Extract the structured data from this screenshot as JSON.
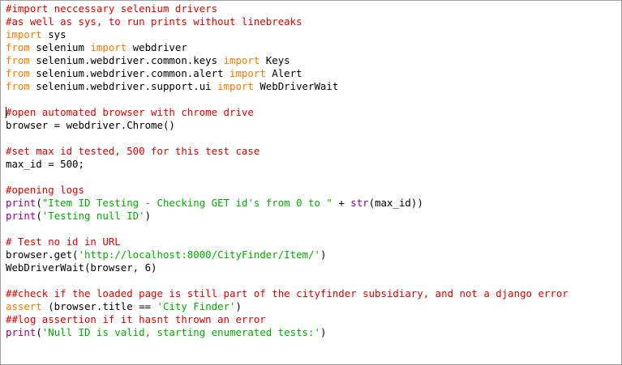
{
  "editor": {
    "colors": {
      "comment": "#dd0000",
      "keyword": "#ff7700",
      "builtin": "#900090",
      "string": "#00aa00",
      "text": "#000000",
      "background": "#ffffff"
    },
    "lines": [
      [
        {
          "t": "#import neccessary selenium drivers",
          "c": "c"
        }
      ],
      [
        {
          "t": "#as well as sys, to run prints without linebreaks",
          "c": "c"
        }
      ],
      [
        {
          "t": "import",
          "c": "k"
        },
        {
          "t": " sys",
          "c": "p"
        }
      ],
      [
        {
          "t": "from",
          "c": "k"
        },
        {
          "t": " selenium ",
          "c": "p"
        },
        {
          "t": "import",
          "c": "k"
        },
        {
          "t": " webdriver",
          "c": "p"
        }
      ],
      [
        {
          "t": "from",
          "c": "k"
        },
        {
          "t": " selenium.webdriver.common.keys ",
          "c": "p"
        },
        {
          "t": "import",
          "c": "k"
        },
        {
          "t": " Keys",
          "c": "p"
        }
      ],
      [
        {
          "t": "from",
          "c": "k"
        },
        {
          "t": " selenium.webdriver.common.alert ",
          "c": "p"
        },
        {
          "t": "import",
          "c": "k"
        },
        {
          "t": " Alert",
          "c": "p"
        }
      ],
      [
        {
          "t": "from",
          "c": "k"
        },
        {
          "t": " selenium.webdriver.support.ui ",
          "c": "p"
        },
        {
          "t": "import",
          "c": "k"
        },
        {
          "t": " WebDriverWait",
          "c": "p"
        }
      ],
      [],
      [
        {
          "t": "#open automated browser with chrome drive",
          "c": "c",
          "caret": true
        }
      ],
      [
        {
          "t": "browser = webdriver.Chrome()",
          "c": "p"
        }
      ],
      [],
      [
        {
          "t": "#set max id tested, 500 for this test case",
          "c": "c"
        }
      ],
      [
        {
          "t": "max_id = 500;",
          "c": "p"
        }
      ],
      [],
      [
        {
          "t": "#opening logs",
          "c": "c"
        }
      ],
      [
        {
          "t": "print",
          "c": "b"
        },
        {
          "t": "(",
          "c": "p"
        },
        {
          "t": "\"Item ID Testing - Checking GET id's from 0 to \"",
          "c": "s"
        },
        {
          "t": " + ",
          "c": "p"
        },
        {
          "t": "str",
          "c": "b"
        },
        {
          "t": "(max_id))",
          "c": "p"
        }
      ],
      [
        {
          "t": "print",
          "c": "b"
        },
        {
          "t": "(",
          "c": "p"
        },
        {
          "t": "'Testing null ID'",
          "c": "s"
        },
        {
          "t": ")",
          "c": "p"
        }
      ],
      [],
      [
        {
          "t": "# Test no id in URL",
          "c": "c"
        }
      ],
      [
        {
          "t": "browser.get(",
          "c": "p"
        },
        {
          "t": "'http://localhost:8000/CityFinder/Item/'",
          "c": "s"
        },
        {
          "t": ")",
          "c": "p"
        }
      ],
      [
        {
          "t": "WebDriverWait(browser, 6)",
          "c": "p"
        }
      ],
      [],
      [
        {
          "t": "##check if the loaded page is still part of the cityfinder subsidiary, and not a django error",
          "c": "c"
        }
      ],
      [
        {
          "t": "assert",
          "c": "k"
        },
        {
          "t": " (browser.title == ",
          "c": "p"
        },
        {
          "t": "'City Finder'",
          "c": "s"
        },
        {
          "t": ")",
          "c": "p"
        }
      ],
      [
        {
          "t": "##log assertion if it hasnt thrown an error",
          "c": "c"
        }
      ],
      [
        {
          "t": "print",
          "c": "b"
        },
        {
          "t": "(",
          "c": "p"
        },
        {
          "t": "'Null ID is valid, starting enumerated tests:'",
          "c": "s"
        },
        {
          "t": ")",
          "c": "p"
        }
      ]
    ]
  }
}
